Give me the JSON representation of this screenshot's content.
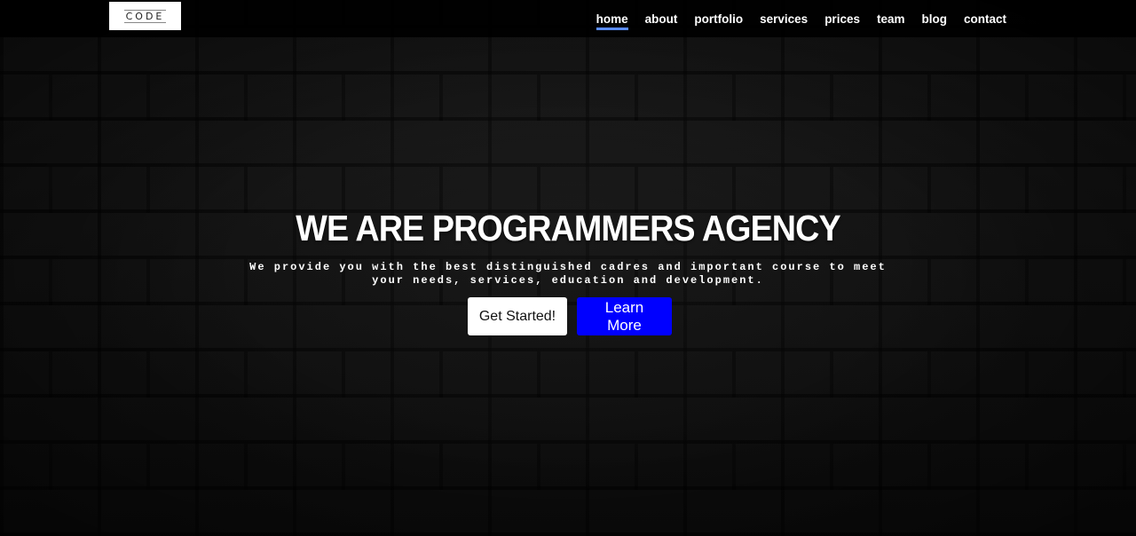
{
  "brand": {
    "logo_text": "CODE"
  },
  "nav": {
    "items": [
      {
        "label": "home",
        "active": true
      },
      {
        "label": "about",
        "active": false
      },
      {
        "label": "portfolio",
        "active": false
      },
      {
        "label": "services",
        "active": false
      },
      {
        "label": "prices",
        "active": false
      },
      {
        "label": "team",
        "active": false
      },
      {
        "label": "blog",
        "active": false
      },
      {
        "label": "contact",
        "active": false
      }
    ]
  },
  "hero": {
    "title": "WE ARE PROGRAMMERS AGENCY",
    "subtitle": "We provide you with the best distinguished cadres and important course to meet your needs, services, education and development.",
    "primary_button": "Get Started!",
    "secondary_button": "Learn More"
  },
  "colors": {
    "nav_active_underline": "#5a8cff",
    "learn_more_bg": "#0000ff",
    "background": "#0d0d0d"
  }
}
